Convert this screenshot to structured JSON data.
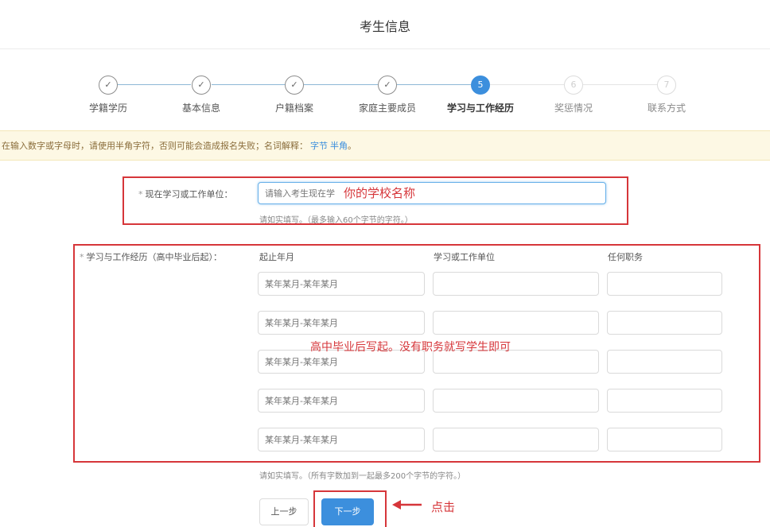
{
  "header": {
    "title": "考生信息"
  },
  "steps": [
    {
      "num": "✓",
      "label": "学籍学历",
      "state": "done"
    },
    {
      "num": "✓",
      "label": "基本信息",
      "state": "done"
    },
    {
      "num": "✓",
      "label": "户籍档案",
      "state": "done"
    },
    {
      "num": "✓",
      "label": "家庭主要成员",
      "state": "done"
    },
    {
      "num": "5",
      "label": "学习与工作经历",
      "state": "active"
    },
    {
      "num": "6",
      "label": "奖惩情况",
      "state": "todo"
    },
    {
      "num": "7",
      "label": "联系方式",
      "state": "todo"
    }
  ],
  "notice": {
    "text": "在输入数字或字母时，请使用半角字符，否则可能会造成报名失败；名词解释：",
    "link1": "字节",
    "link2": "半角"
  },
  "current_unit": {
    "label": "现在学习或工作单位：",
    "placeholder": "请输入考生现在学",
    "hint": "请如实填写。（最多输入60个字节的字符。）",
    "annotation": "你的学校名称"
  },
  "history": {
    "label": "学习与工作经历（高中毕业后起）：",
    "columns": [
      "起止年月",
      "学习或工作单位",
      "任何职务"
    ],
    "date_placeholder": "某年某月-某年某月",
    "hint": "请如实填写。（所有字数加到一起最多200个字节的字符。）",
    "annotation": "高中毕业后写起。没有职务就写学生即可"
  },
  "buttons": {
    "prev": "上一步",
    "next": "下一步"
  },
  "click_annotation": "点击",
  "colors": {
    "primary": "#3c8fdd",
    "annotation_red": "#d6363a",
    "notice_bg": "#fdf8e4"
  }
}
